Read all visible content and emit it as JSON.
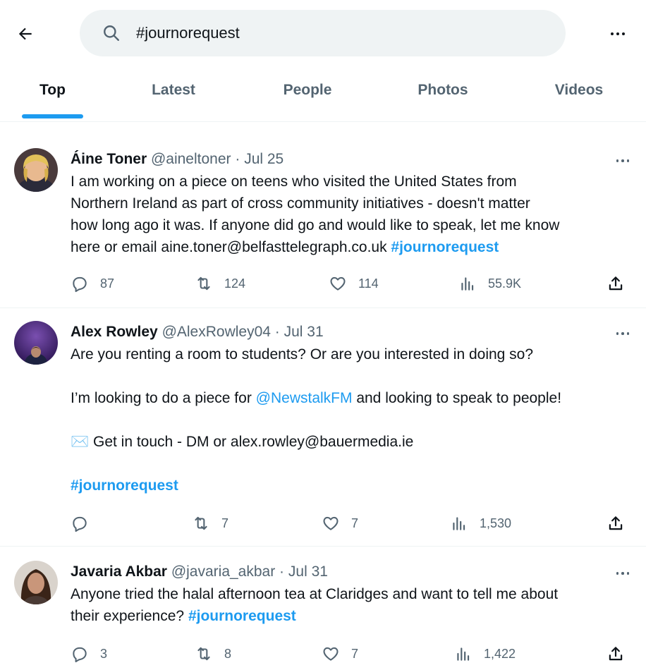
{
  "search": {
    "query": "#journorequest"
  },
  "tabs": [
    {
      "label": "Top"
    },
    {
      "label": "Latest"
    },
    {
      "label": "People"
    },
    {
      "label": "Photos"
    },
    {
      "label": "Videos"
    }
  ],
  "tweets": [
    {
      "name": "Áine Toner",
      "handle": "@aineltoner",
      "date": "Jul 25",
      "text_1": "I am working on a piece on teens who visited the United States from\nNorthern Ireland as part of cross community initiatives - doesn't matter\nhow long ago it was. If anyone did go and would like to speak, let me know\nhere or email aine.toner@belfasttelegraph.co.uk ",
      "hashtag": "#journorequest",
      "stats": {
        "replies": "87",
        "retweets": "124",
        "likes": "114",
        "views": "55.9K"
      }
    },
    {
      "name": "Alex Rowley",
      "handle": "@AlexRowley04",
      "date": "Jul 31",
      "text_1": "Are you renting a room to students? Or are you interested in doing so?\n\nI’m looking to do a piece for ",
      "mention": "@NewstalkFM",
      "text_2": " and looking to speak to people!\n\n",
      "envelope_glyph": "✉️",
      "text_3": " Get in touch - DM or alex.rowley@bauermedia.ie\n\n",
      "hashtag": "#journorequest",
      "stats": {
        "replies": "",
        "retweets": "7",
        "likes": "7",
        "views": "1,530"
      }
    },
    {
      "name": "Javaria Akbar",
      "handle": "@javaria_akbar",
      "date": "Jul 31",
      "text_1": "Anyone tried the halal afternoon tea at Claridges and want to tell me about\ntheir experience? ",
      "hashtag": "#journorequest",
      "stats": {
        "replies": "3",
        "retweets": "8",
        "likes": "7",
        "views": "1,422"
      }
    }
  ],
  "separator": " · ",
  "colors": {
    "accent": "#1d9bf0",
    "text": "#0f1419",
    "muted": "#536471",
    "search_bg": "#eff3f4"
  }
}
